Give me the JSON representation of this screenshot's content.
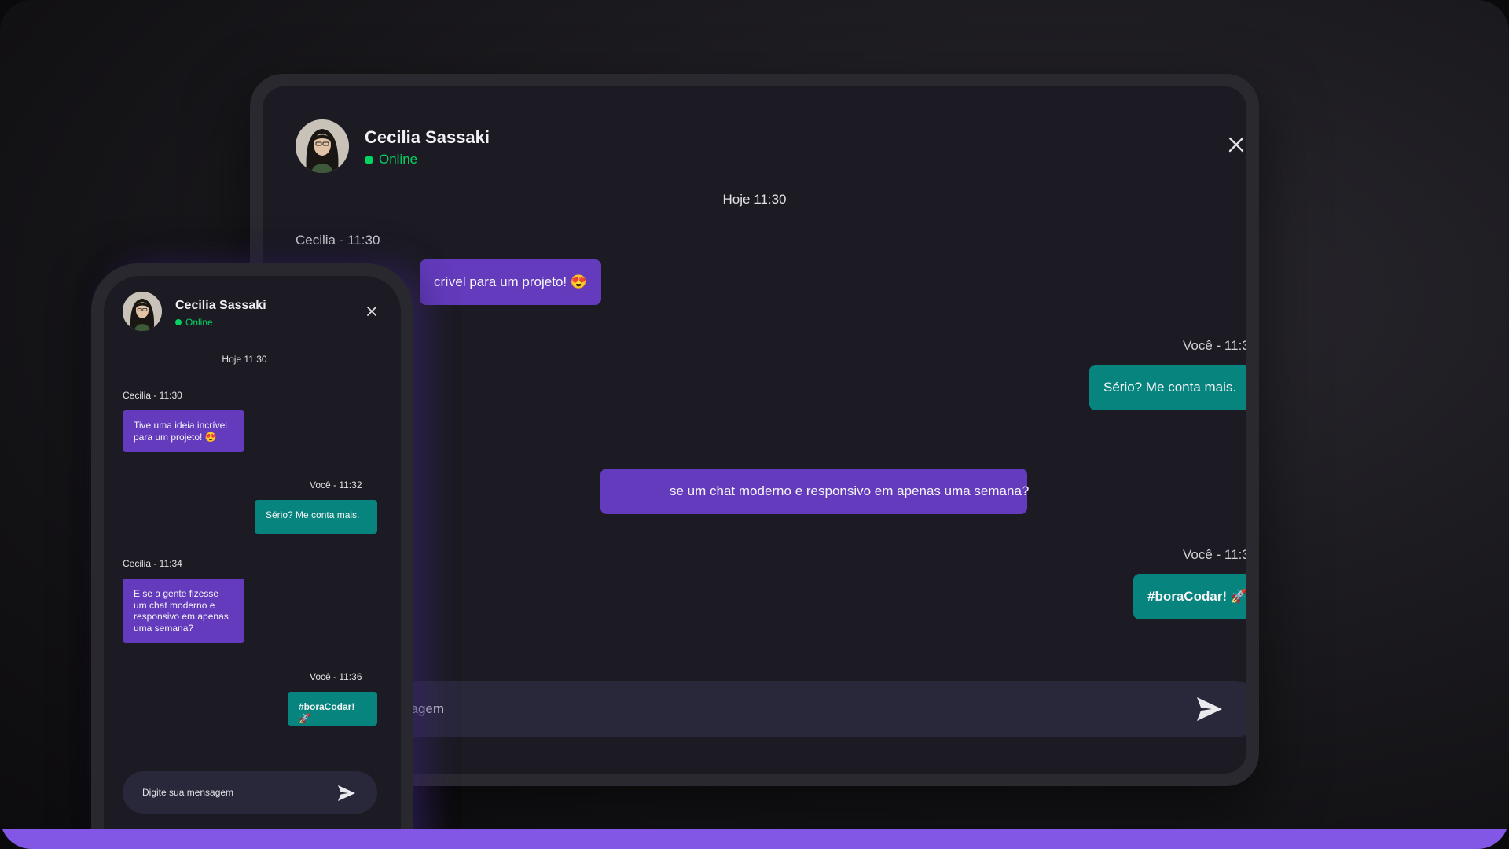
{
  "colors": {
    "accent_purple": "#633bbc",
    "accent_teal": "#07847e",
    "online_green": "#04d361",
    "background": "#1c1b23",
    "brand_bar": "#8257e5"
  },
  "desktop": {
    "header": {
      "name": "Cecilia Sassaki",
      "status": "Online",
      "close_icon": "close-icon"
    },
    "day_label": "Hoje 11:30",
    "messages": [
      {
        "meta": "Cecilia - 11:30",
        "text": "crível para um projeto! 😍"
      },
      {
        "meta": "Você - 11:3",
        "text": "Sério? Me conta mais."
      },
      {
        "text": "se um chat moderno e responsivo em apenas uma semana?"
      },
      {
        "meta": "Você - 11:3",
        "text": "#boraCodar! 🚀"
      }
    ],
    "input": {
      "value": "sagem",
      "send_icon": "send-icon"
    }
  },
  "phone": {
    "header": {
      "name": "Cecilia Sassaki",
      "status": "Online",
      "close_icon": "close-icon"
    },
    "day_label": "Hoje 11:30",
    "messages": [
      {
        "meta": "Cecilia - 11:30",
        "text": "Tive uma ideia incrível para um projeto! 😍"
      },
      {
        "meta": "Você - 11:32",
        "text": "Sério? Me conta mais."
      },
      {
        "meta": "Cecilia - 11:34",
        "text": "E se a gente fizesse um chat moderno e responsivo em apenas uma semana?"
      },
      {
        "meta": "Você - 11:36",
        "text": "#boraCodar! 🚀"
      }
    ],
    "input": {
      "placeholder": "Digite sua mensagem",
      "send_icon": "send-icon"
    }
  }
}
